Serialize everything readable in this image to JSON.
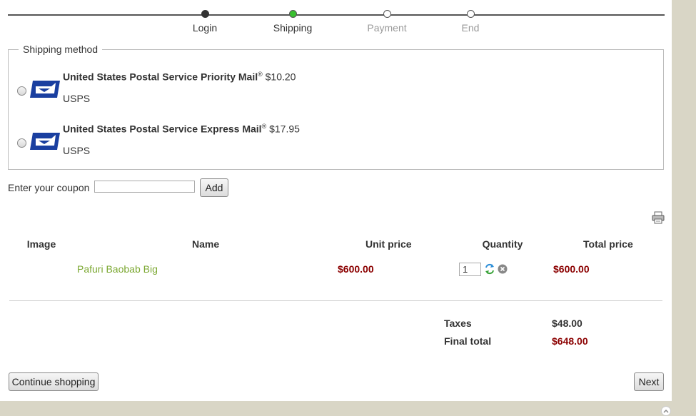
{
  "steps": [
    {
      "label": "Login",
      "state": "done"
    },
    {
      "label": "Shipping",
      "state": "current"
    },
    {
      "label": "Payment",
      "state": "pending"
    },
    {
      "label": "End",
      "state": "pending"
    }
  ],
  "shipping": {
    "legend": "Shipping method",
    "methods": [
      {
        "name": "United States Postal Service Priority Mail",
        "reg": "®",
        "price": "$10.20",
        "carrier": "USPS",
        "icon": "usps-logo-icon"
      },
      {
        "name": "United States Postal Service Express Mail",
        "reg": "®",
        "price": "$17.95",
        "carrier": "USPS",
        "icon": "usps-logo-icon"
      }
    ]
  },
  "coupon": {
    "label": "Enter your coupon",
    "value": "",
    "add_label": "Add"
  },
  "cart": {
    "headers": {
      "image": "Image",
      "name": "Name",
      "unit_price": "Unit price",
      "quantity": "Quantity",
      "total_price": "Total price"
    },
    "items": [
      {
        "name": "Pafuri Baobab Big",
        "unit_price": "$600.00",
        "quantity": "1",
        "total_price": "$600.00"
      }
    ]
  },
  "totals": {
    "taxes_label": "Taxes",
    "taxes_value": "$48.00",
    "final_label": "Final total",
    "final_value": "$648.00"
  },
  "buttons": {
    "continue": "Continue shopping",
    "next": "Next"
  },
  "colors": {
    "accent_price": "#8b0000",
    "product_link": "#7ca832",
    "current_step": "#39c02f",
    "usps_blue": "#1a3fa0"
  }
}
